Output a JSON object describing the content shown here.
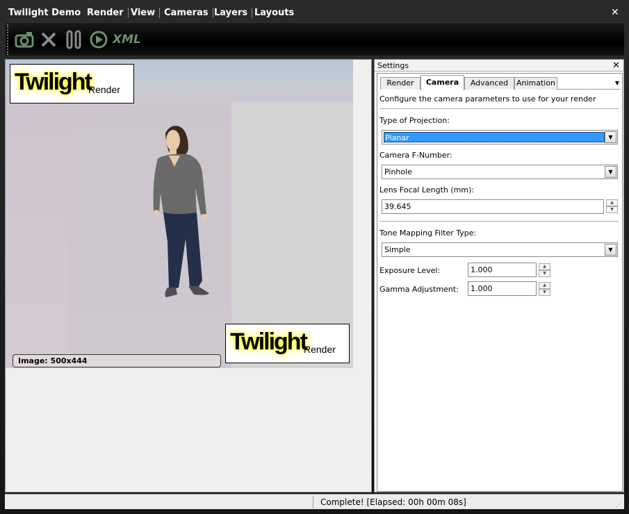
{
  "window": {
    "title": "Twilight Demo",
    "close_glyph": "✕"
  },
  "menu": {
    "items": [
      {
        "label": "Render"
      },
      {
        "label": "View"
      },
      {
        "label": "Cameras"
      },
      {
        "label": "Layers"
      },
      {
        "label": "Layouts"
      }
    ]
  },
  "toolbar": {
    "buttons": [
      {
        "icon": "camera-icon"
      },
      {
        "icon": "cancel-icon"
      },
      {
        "icon": "pause-icon"
      },
      {
        "icon": "refresh-icon"
      },
      {
        "icon": "xml-icon",
        "label": "XML"
      }
    ]
  },
  "render": {
    "image_size": "Image: 500x444",
    "logo_big": "Twilight",
    "logo_small": "Render"
  },
  "settings": {
    "title": "Settings",
    "tabs": [
      {
        "label": "Render"
      },
      {
        "label": "Camera",
        "active": true
      },
      {
        "label": "Advanced"
      },
      {
        "label": "Animation"
      }
    ],
    "description": "Configure the camera parameters to use for your render",
    "projection": {
      "label": "Type of Projection:",
      "value": "Planar"
    },
    "fnumber": {
      "label": "Camera F-Number:",
      "value": "Pinhole"
    },
    "focal": {
      "label": "Lens Focal Length (mm):",
      "value": "39.645"
    },
    "tonemap": {
      "label": "Tone Mapping Filter Type:",
      "value": "Simple"
    },
    "exposure": {
      "label": "Exposure Level:",
      "value": "1.000"
    },
    "gamma": {
      "label": "Gamma Adjustment:",
      "value": "1.000"
    }
  },
  "status": {
    "text": "Complete!  [Elapsed: 00h 00m 08s]"
  }
}
